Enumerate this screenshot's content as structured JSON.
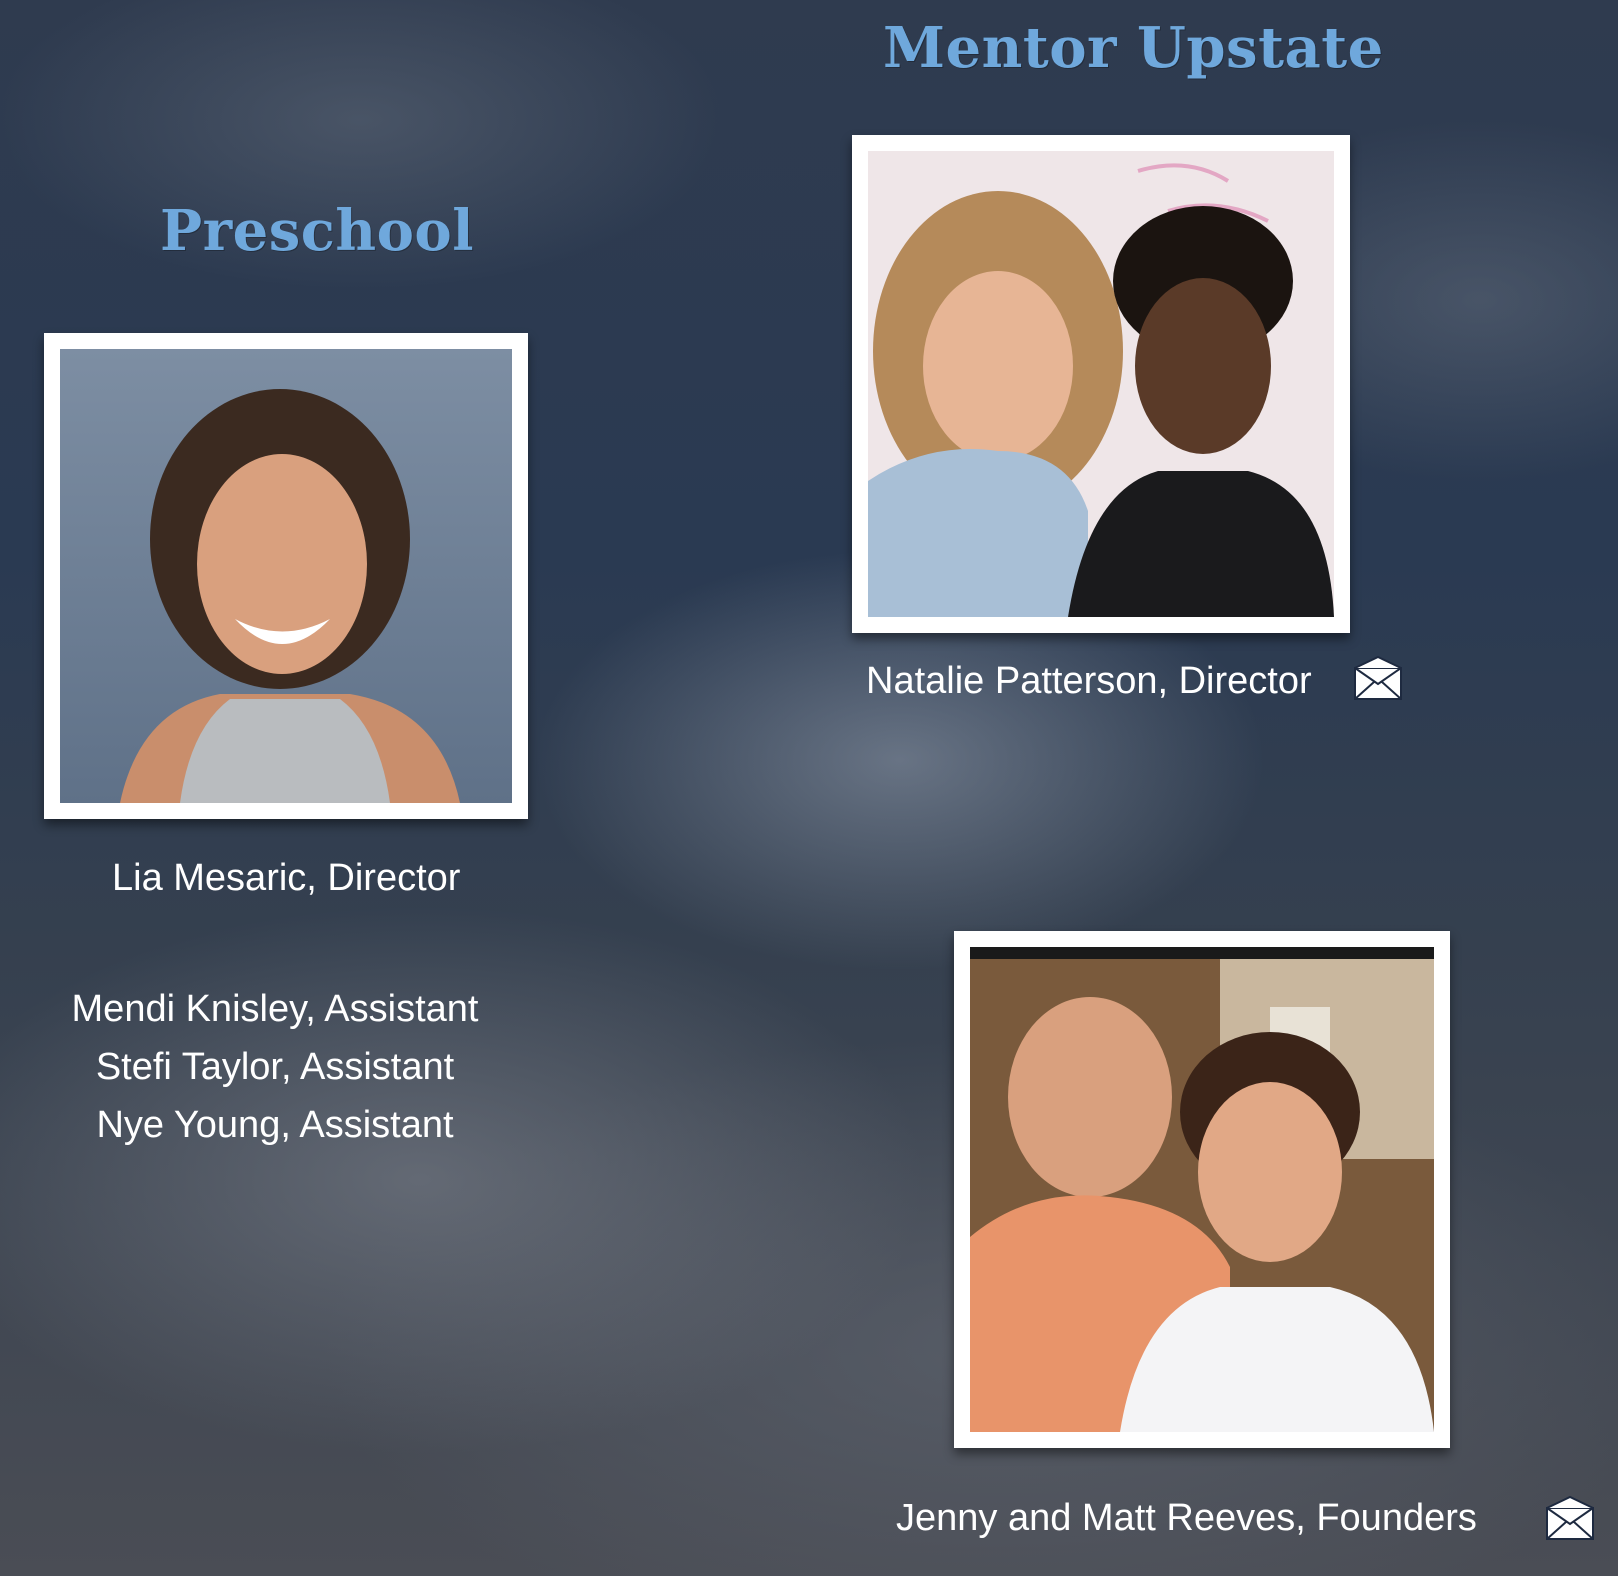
{
  "preschool": {
    "heading": "Preschool",
    "director": "Lia Mesaric, Director",
    "assistants": [
      "Mendi Knisley, Assistant",
      "Stefi Taylor, Assistant",
      "Nye Young, Assistant"
    ]
  },
  "mentor": {
    "heading": "Mentor Upstate",
    "director": "Natalie Patterson, Director",
    "founders": "Jenny and Matt Reeves, Founders"
  },
  "icons": {
    "mail": "envelope-icon"
  },
  "colors": {
    "heading": "#6fa8dc",
    "caption": "#ffffff",
    "frame": "#ffffff"
  }
}
